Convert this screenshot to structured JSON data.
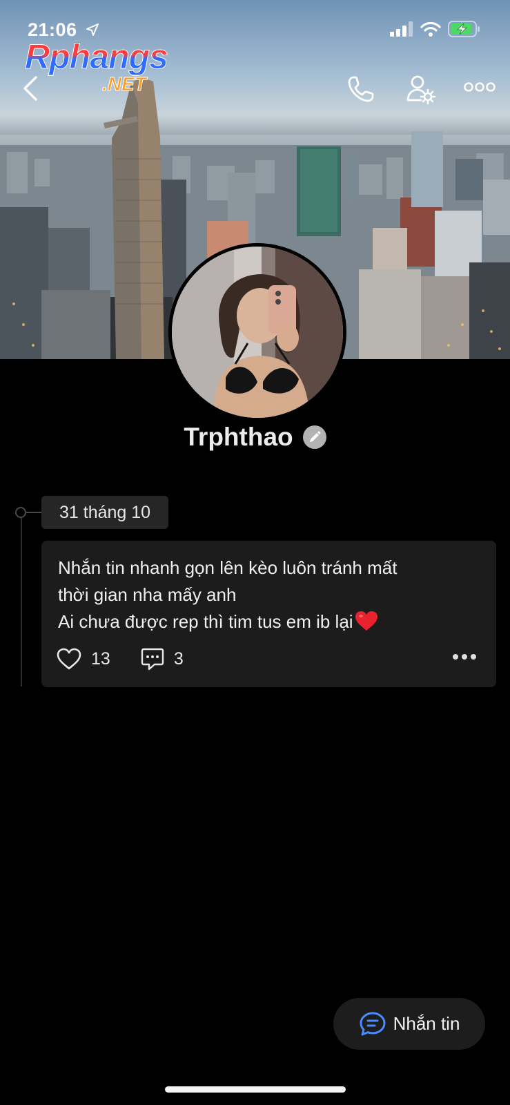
{
  "status_bar": {
    "time": "21:06",
    "icons": [
      "location-arrow-icon",
      "signal-icon",
      "wifi-icon",
      "battery-charging-icon"
    ]
  },
  "watermark": {
    "main": "Rphangs",
    "sub": ".NET"
  },
  "nav": {
    "icons": [
      "back-icon",
      "phone-icon",
      "profile-settings-icon",
      "more-icon"
    ]
  },
  "profile": {
    "name": "Trphthao",
    "badge_icon": "pencil-icon"
  },
  "timeline": {
    "date": "31 tháng 10",
    "post": {
      "lines": [
        "Nhắn tin nhanh gọn lên kèo luôn tránh mất",
        "thời gian nha mấy anh",
        "Ai chưa được rep thì tim tus em ib lại"
      ],
      "emoji": "red-heart-emoji",
      "likes": "13",
      "comments": "3"
    }
  },
  "message_button": {
    "label": "Nhắn tin",
    "icon": "chat-bubble-icon"
  },
  "colors": {
    "background": "#000000",
    "card": "#1c1c1c",
    "chip": "#262626",
    "accent_blue": "#4a8cff",
    "heart_red": "#e8232e",
    "battery_green": "#4cd964"
  }
}
